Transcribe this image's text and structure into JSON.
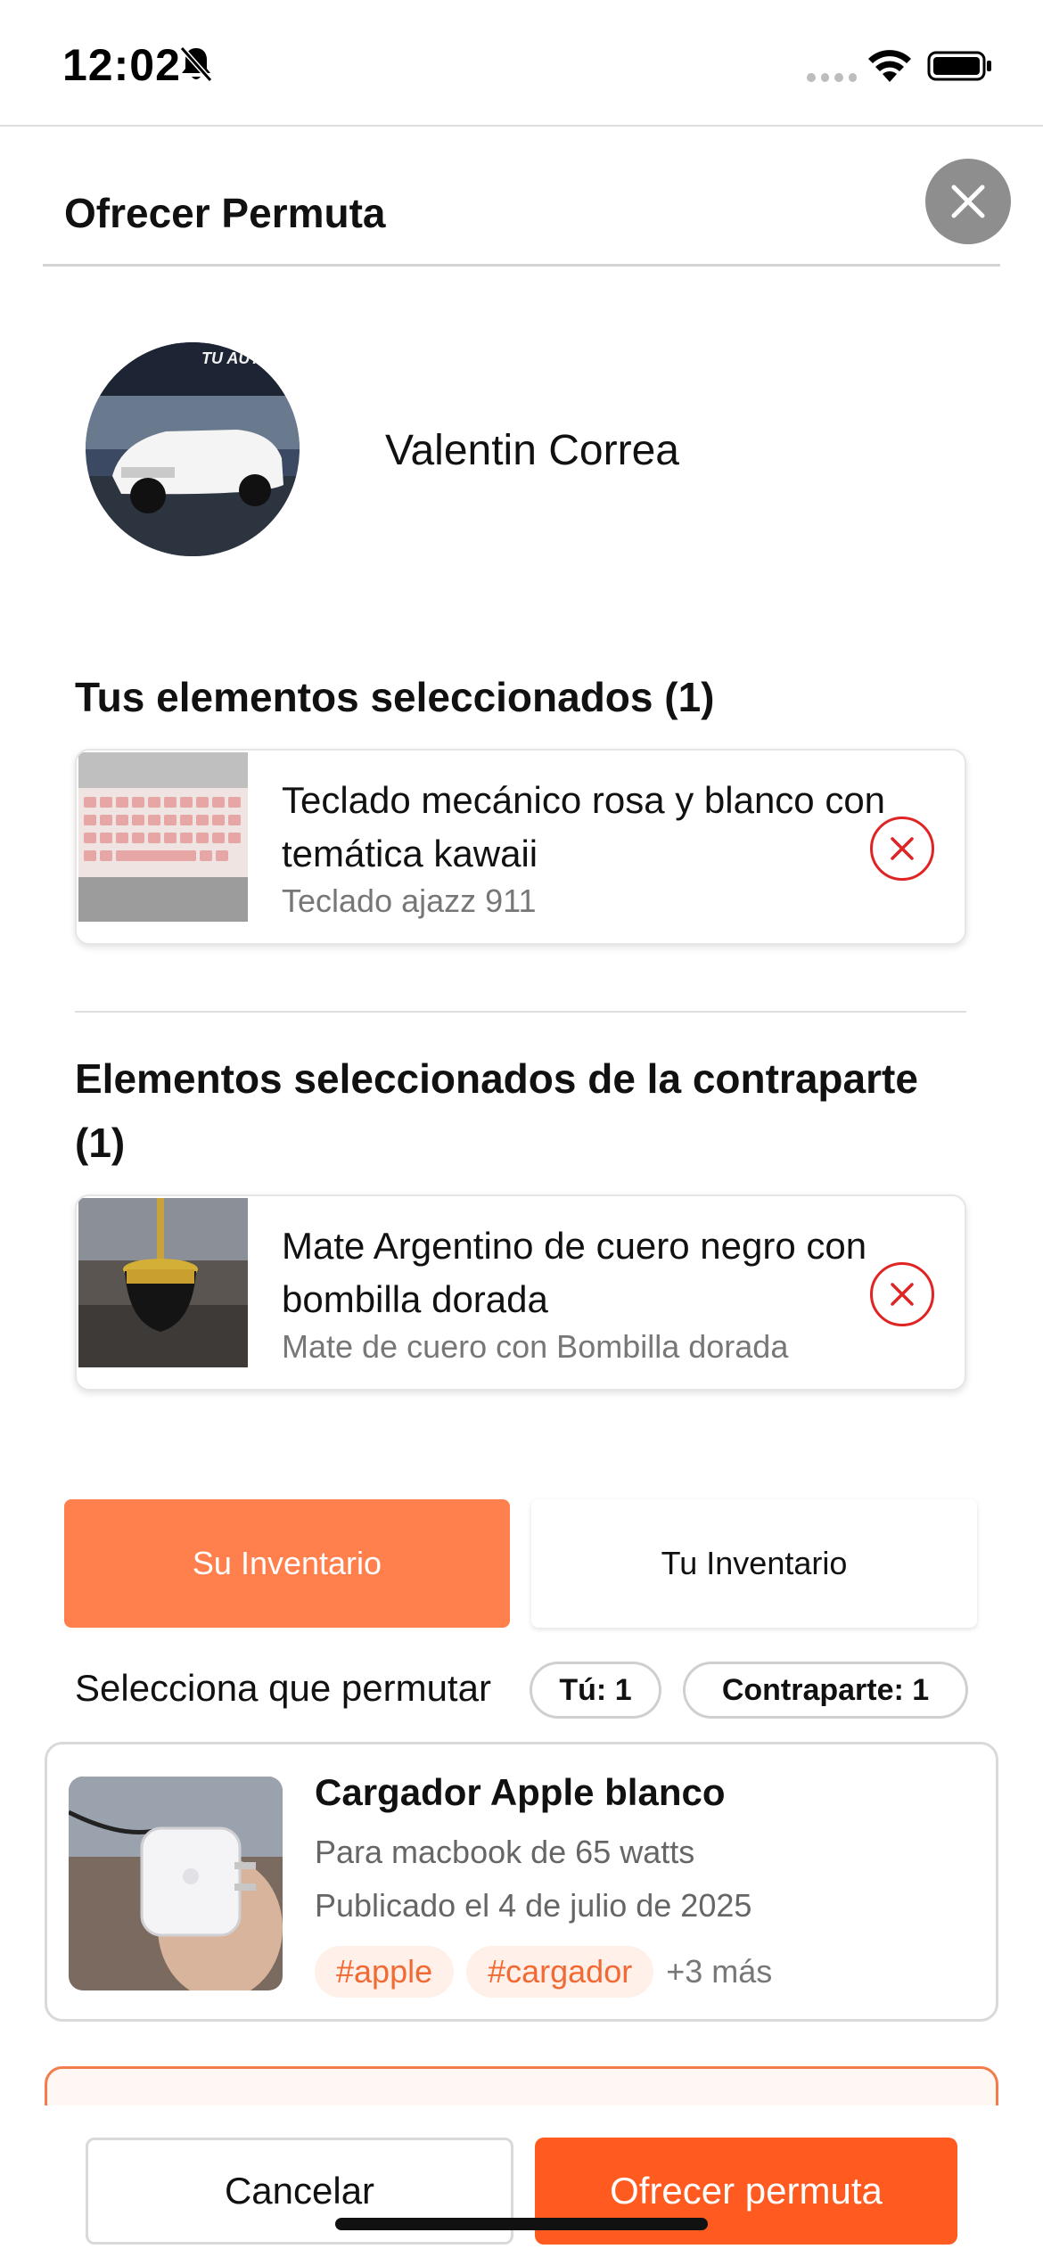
{
  "status_bar": {
    "time": "12:02"
  },
  "header": {
    "title": "Ofrecer Permuta"
  },
  "profile": {
    "name": "Valentin Correa",
    "avatar_text": "TU AUTO"
  },
  "my_selected": {
    "title": "Tus elementos seleccionados (1)",
    "items": [
      {
        "title": "Teclado mecánico rosa y blanco con temática kawaii",
        "subtitle": "Teclado ajazz 911"
      }
    ]
  },
  "counterpart_selected": {
    "title": "Elementos seleccionados de la contraparte (1)",
    "items": [
      {
        "title": "Mate Argentino de cuero negro con bombilla dorada",
        "subtitle": "Mate de cuero con Bombilla dorada"
      }
    ]
  },
  "tabs": {
    "their_inventory": "Su Inventario",
    "your_inventory": "Tu Inventario",
    "active": "their_inventory"
  },
  "selection": {
    "label": "Selecciona que permutar",
    "you_pill": "Tú: 1",
    "counterpart_pill": "Contraparte: 1"
  },
  "inventory": [
    {
      "title": "Cargador Apple blanco",
      "description": "Para macbook de 65 watts",
      "date": "Publicado el 4 de julio de 2025",
      "tags": [
        "#apple",
        "#cargador"
      ],
      "more": "+3 más"
    }
  ],
  "actions": {
    "cancel": "Cancelar",
    "offer": "Ofrecer permuta"
  },
  "colors": {
    "accent": "#ff7f4d",
    "primary_button": "#ff5a1f",
    "remove": "#e02424",
    "tag_text": "#f26a33"
  }
}
